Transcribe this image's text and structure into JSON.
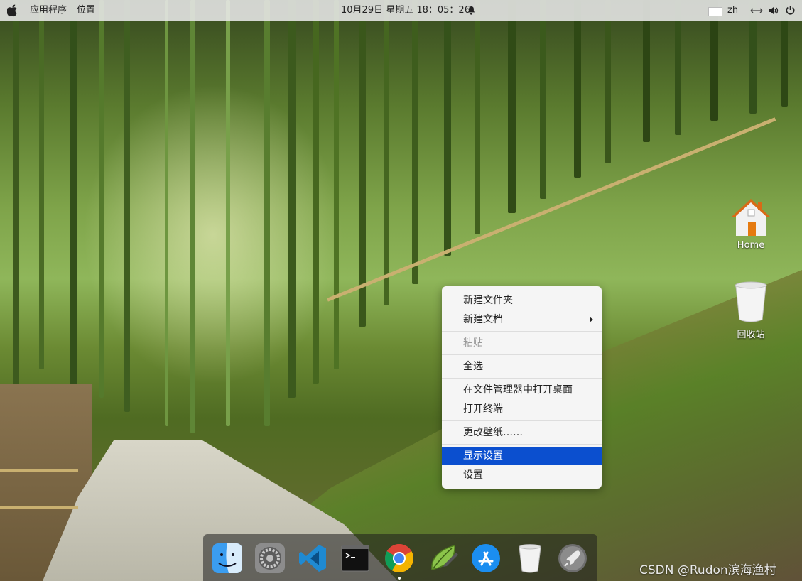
{
  "topbar": {
    "apps_menu": "应用程序",
    "places_menu": "位置",
    "datetime": "10月29日 星期五  18：05：26",
    "input_method": "zh"
  },
  "desktop_icons": {
    "home_label": "Home",
    "trash_label": "回收站"
  },
  "context_menu": {
    "items": [
      {
        "label": "新建文件夹"
      },
      {
        "label": "新建文档"
      },
      {
        "label": "粘贴"
      },
      {
        "label": "全选"
      },
      {
        "label": "在文件管理器中打开桌面"
      },
      {
        "label": "打开终端"
      },
      {
        "label": "更改壁纸……"
      },
      {
        "label": "显示设置"
      },
      {
        "label": "设置"
      }
    ],
    "highlight_color": "#0b4fcf"
  },
  "dock": {
    "icons": [
      "finder-icon",
      "system-preferences-icon",
      "vscode-icon",
      "terminal-icon",
      "chrome-icon",
      "text-editor-icon",
      "app-store-icon",
      "trash-icon",
      "launchpad-icon"
    ]
  },
  "watermark": "CSDN @Rudon滨海渔村"
}
